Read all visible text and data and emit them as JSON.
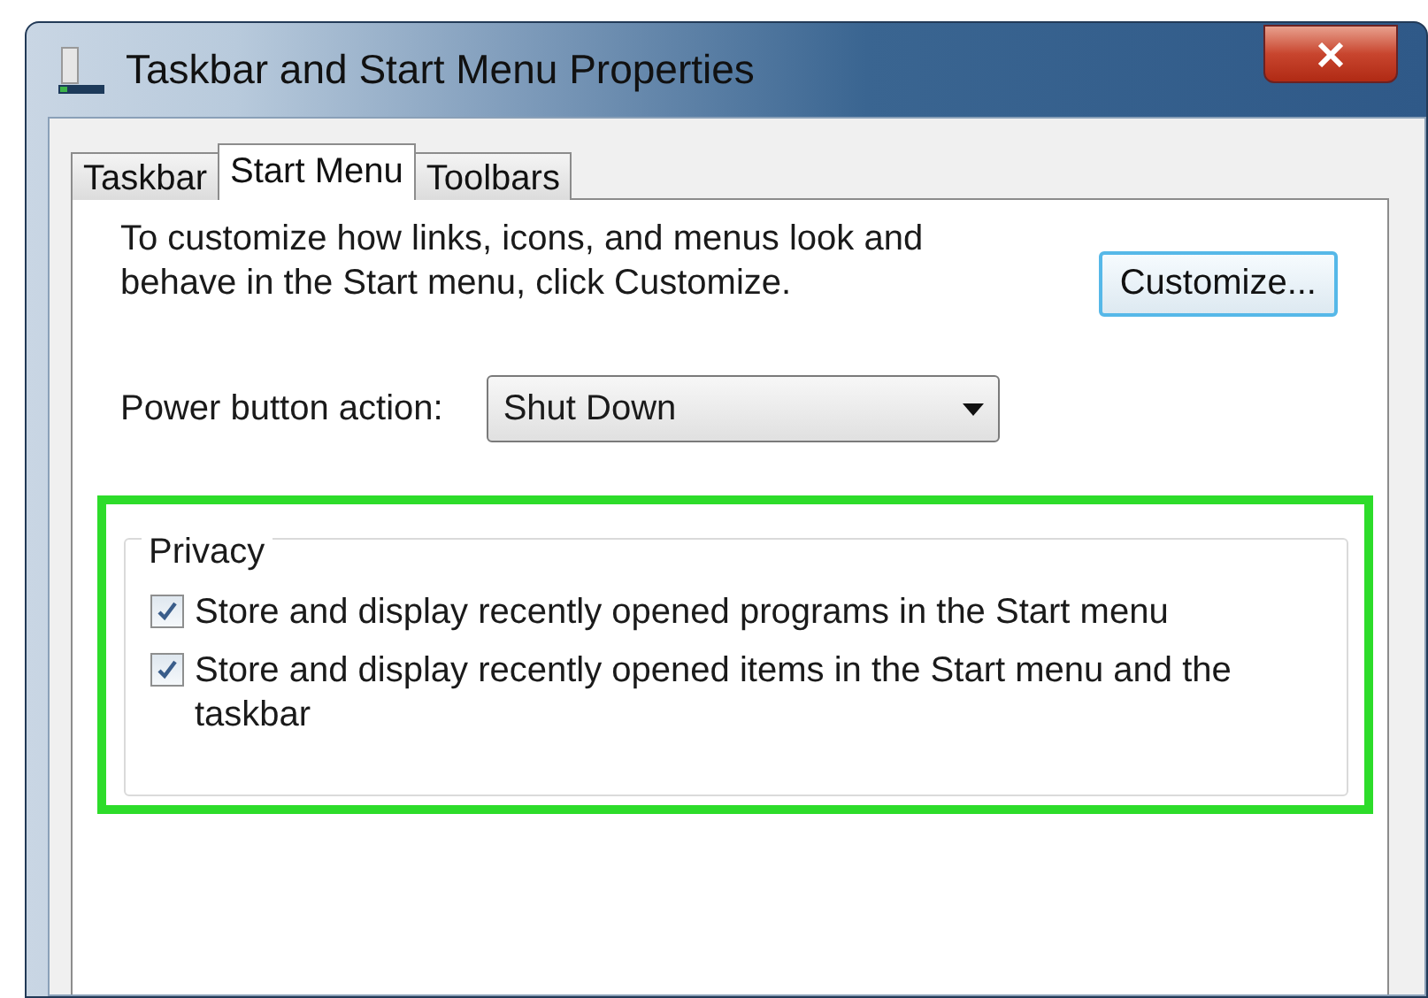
{
  "window": {
    "title": "Taskbar and Start Menu Properties"
  },
  "tabs": [
    {
      "label": "Taskbar",
      "selected": false
    },
    {
      "label": "Start Menu",
      "selected": true
    },
    {
      "label": "Toolbars",
      "selected": false
    }
  ],
  "description": "To customize how links, icons, and menus look and behave in the Start menu, click Customize.",
  "customize_button": "Customize...",
  "power_button": {
    "label": "Power button action:",
    "value": "Shut Down"
  },
  "privacy": {
    "title": "Privacy",
    "options": [
      {
        "label": "Store and display recently opened programs in the Start menu",
        "checked": true
      },
      {
        "label": "Store and display recently opened items in the Start menu and the taskbar",
        "checked": true
      }
    ]
  }
}
